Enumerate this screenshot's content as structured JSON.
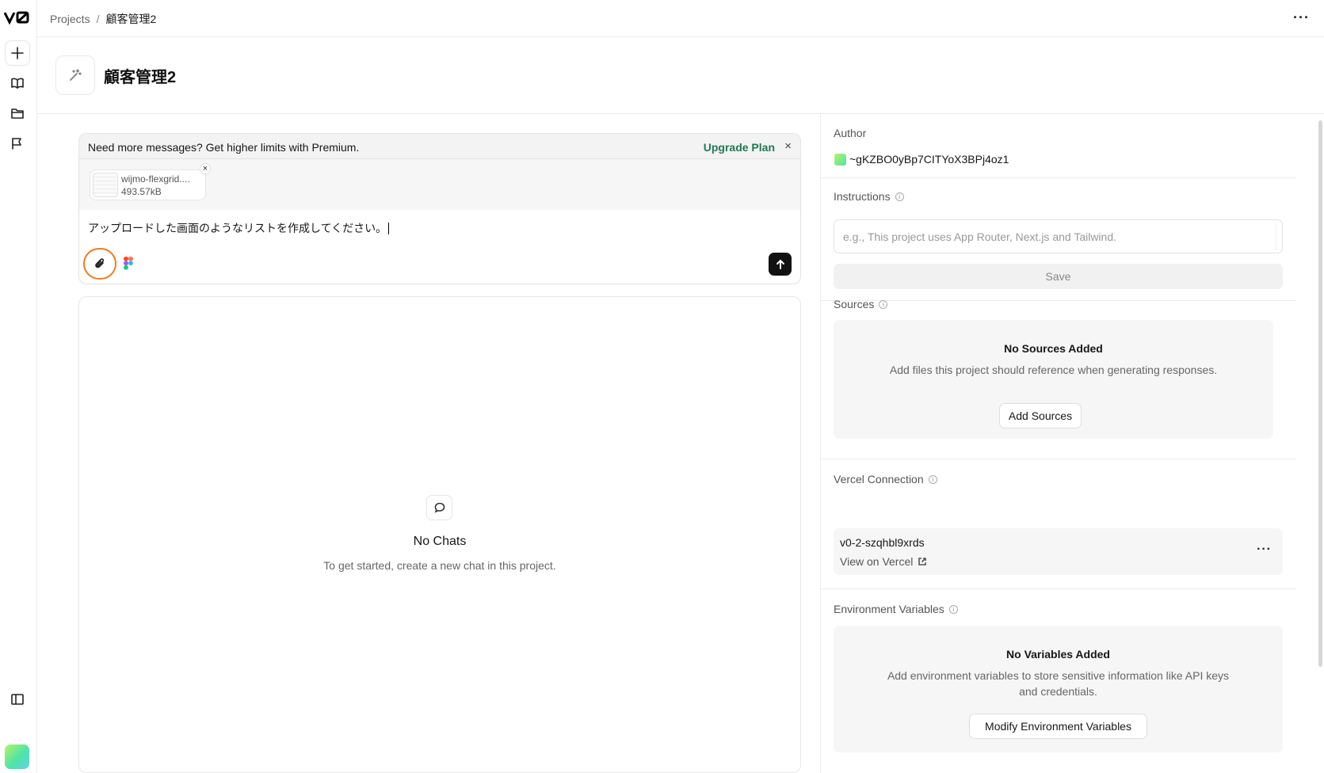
{
  "rail": {
    "logo": "v0",
    "items": [
      "new-chat",
      "docs",
      "projects",
      "feedback",
      "toggle-sidebar",
      "user-avatar"
    ]
  },
  "breadcrumb": {
    "root": "Projects",
    "separator": "/",
    "current": "顧客管理2"
  },
  "project": {
    "title": "顧客管理2"
  },
  "banner": {
    "message": "Need more messages? Get higher limits with Premium.",
    "cta": "Upgrade Plan",
    "close": "×"
  },
  "composer": {
    "attachment": {
      "name": "wijmo-flexgrid....",
      "size": "493.57kB",
      "remove": "×"
    },
    "text": "アップロードした画面のようなリストを作成してください。"
  },
  "chats": {
    "empty_title": "No Chats",
    "empty_desc": "To get started, create a new chat in this project."
  },
  "sidebar": {
    "author": {
      "label": "Author",
      "name": "~gKZBO0yBp7CITYoX3BPj4oz1"
    },
    "instructions": {
      "label": "Instructions",
      "placeholder": "e.g., This project uses App Router, Next.js and Tailwind.",
      "save": "Save"
    },
    "sources": {
      "label": "Sources",
      "empty_title": "No Sources Added",
      "empty_desc": "Add files this project should reference when generating responses.",
      "button": "Add Sources"
    },
    "vercel": {
      "label": "Vercel Connection",
      "project": "v0-2-szqhbl9xrds",
      "link": "View on Vercel"
    },
    "env": {
      "label": "Environment Variables",
      "empty_title": "No Variables Added",
      "empty_desc": "Add environment variables to store sensitive information like API keys and credentials.",
      "button": "Modify Environment Variables"
    }
  },
  "colors": {
    "accent_link": "#1f7a55",
    "focus_ring": "#f07b20",
    "send_button": "#111111"
  }
}
